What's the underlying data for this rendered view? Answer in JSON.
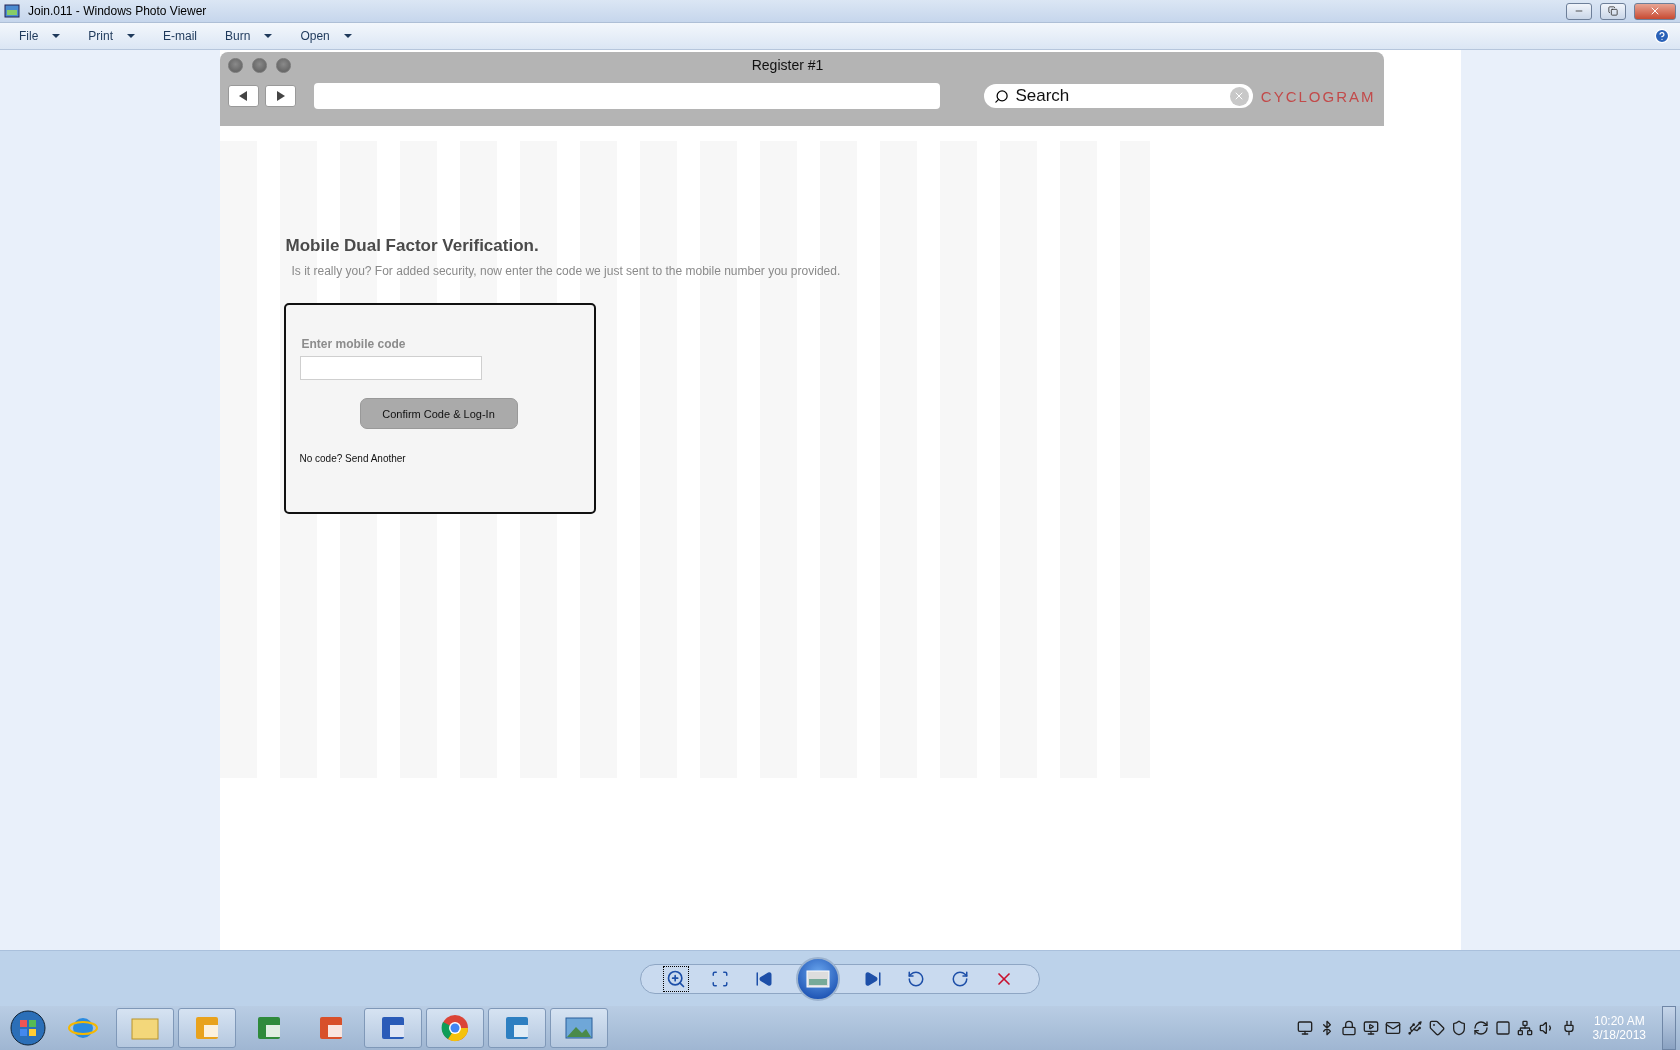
{
  "window": {
    "title": "Join.011 - Windows Photo Viewer"
  },
  "menu": [
    {
      "label": "File",
      "dropdown": true
    },
    {
      "label": "Print",
      "dropdown": true
    },
    {
      "label": "E-mail",
      "dropdown": false
    },
    {
      "label": "Burn",
      "dropdown": true
    },
    {
      "label": "Open",
      "dropdown": true
    }
  ],
  "browser": {
    "title": "Register #1",
    "search_placeholder": "Search",
    "brand": "CYCLOGRAM"
  },
  "page": {
    "heading": "Mobile Dual Factor Verification.",
    "intro": "Is it really you?  For added security, now enter the code we just sent to the mobile number you provided.",
    "field_label": "Enter mobile code",
    "button": "Confirm Code & Log-In",
    "resend": "No code? Send Another"
  },
  "clock": {
    "time": "10:20 AM",
    "date": "3/18/2013"
  }
}
